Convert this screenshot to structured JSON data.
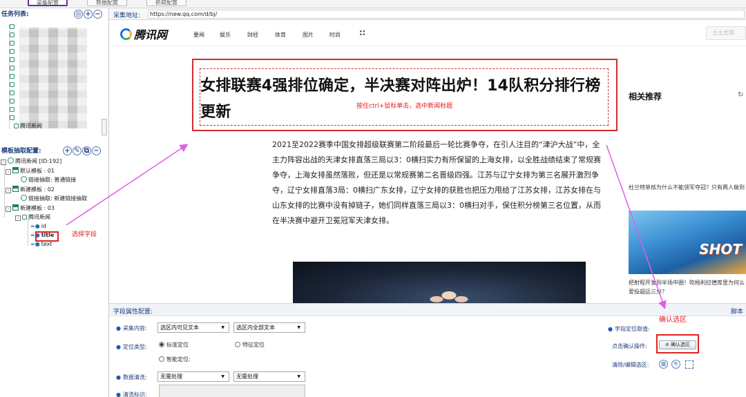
{
  "topbar": {
    "buttons": [
      "采集配置",
      "数据配置",
      "抓取配置"
    ]
  },
  "left": {
    "task_list_title": "任务列表:",
    "task_leaf": "腾讯新闻",
    "extract_title": "模板抽取配置:",
    "tree": [
      "腾讯新闻 [ID:192]",
      "默认模板 : 01",
      "链接抽取: 普通链接",
      "新建模板 : 02",
      "链接抽取: 新建链接抽取",
      "新建模板 : 03",
      "腾讯新闻",
      "id",
      "title",
      "text"
    ],
    "select_field_note": "选择字段"
  },
  "urlbar": {
    "label": "采集地址:",
    "url": "https://new.qq.com/d/bj/"
  },
  "web": {
    "logo": "腾讯网",
    "nav": [
      "要闻",
      "娱乐",
      "财经",
      "体育",
      "图片",
      "时尚"
    ],
    "search_placeholder": "土土女排",
    "headline": "女排联赛4强排位确定，半决赛对阵出炉！14队积分排行榜更新",
    "hint": "按住ctrl+鼠标单击，选中新闻标题",
    "article": "2021至2022赛季中国女排超级联赛第二阶段最后一轮比赛争夺，在引人注目的“津沪大战”中，全主力阵容出战的天津女排直落三局以3：0横扫实力有所保留的上海女排，以全胜战绩结束了常规赛争夺，上海女排虽然落败，但还是以常规赛第二名晋级四强。江苏与辽宁女排为第三名展开激烈争夺，辽宁女排直落3局：0横扫广东女排，辽宁女排的获胜也把压力甩给了江苏女排，江苏女排在与山东女排的比赛中没有掉链子，她们同样直落三局以3：0横扫对手，保住积分榜第三名位置，从而在半决赛中避开卫冕冠军天津女排。",
    "side_title": "相关推荐",
    "refresh_icon": "refresh-icon",
    "side_item1": "杜兰特单核为什么不能领军夺冠？只有两人做到",
    "side_img_text": "SHOT",
    "side_item2": "把射程开发到半场中圈！吹杨利拉德库里为何么爱投超远三分？"
  },
  "config": {
    "title": "字段属性配置:",
    "right_label": "脚本",
    "confirm_note": "确认选区",
    "rows": {
      "content_label": "采集内容:",
      "content_sel1": "选区内可见文本",
      "content_sel2": "选区内全部文本",
      "locate_label": "定位类型:",
      "locate_opt1": "标准定位",
      "locate_opt2": "特征定位",
      "locate_opt3": "智能定位:",
      "clean_label": "数据清洗:",
      "clean_sel1": "无需处理",
      "clean_sel2": "无需处理",
      "mark_label": "清洗标识:"
    },
    "locate_value_label": "字段定位取值:",
    "confirm_label": "点击确认操作:",
    "confirm_button": "确认选区",
    "clear_label": "清除/编辑选区:"
  },
  "colors": {
    "accent": "#1c3f7e",
    "highlight": "#e02020",
    "arrow": "#e05ce8"
  }
}
